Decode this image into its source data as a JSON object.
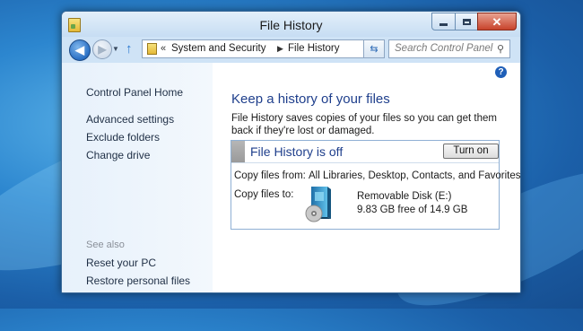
{
  "window": {
    "title": "File History"
  },
  "address_bar": {
    "chevron": "«",
    "crumbs": [
      "System and Security",
      "File History"
    ]
  },
  "search": {
    "placeholder": "Search Control Panel"
  },
  "sidebar": {
    "home": "Control Panel Home",
    "links": [
      "Advanced settings",
      "Exclude folders",
      "Change drive"
    ],
    "see_also_heading": "See also",
    "see_also": [
      "Reset your PC",
      "Restore personal files"
    ]
  },
  "main": {
    "title": "Keep a history of your files",
    "description": "File History saves copies of your files so you can get them back if they're lost or damaged.",
    "status_title": "File History is off",
    "turn_on_label": "Turn on",
    "copy_from_label": "Copy files from:",
    "copy_from_value": "All Libraries, Desktop, Contacts, and Favorites.",
    "copy_to_label": "Copy files to:",
    "drive_name": "Removable Disk (E:)",
    "drive_free": "9.83 GB free of 14.9 GB"
  },
  "colors": {
    "link": "#1f2f45",
    "heading": "#1f3f8c",
    "close_button": "#c7432b",
    "status_off": "#9a9a9a"
  },
  "icons": [
    "back-arrow-icon",
    "forward-arrow-icon",
    "up-arrow-icon",
    "control-panel-icon",
    "refresh-icon",
    "search-icon",
    "help-icon",
    "removable-disk-icon"
  ]
}
